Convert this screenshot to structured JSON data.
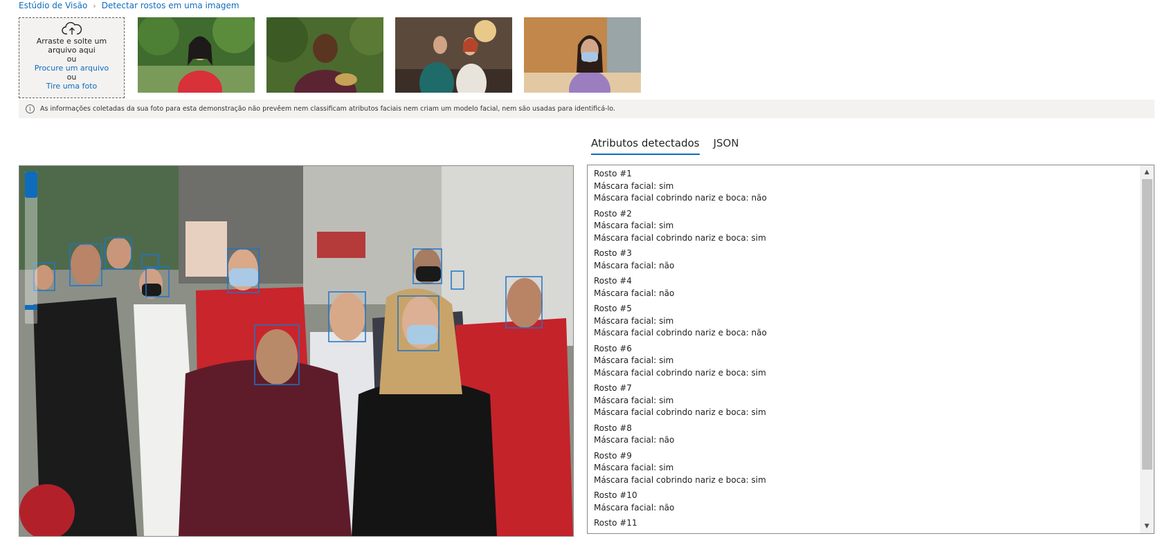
{
  "breadcrumb": {
    "root": "Estúdio de Visão",
    "current": "Detectar rostos em uma imagem"
  },
  "upload": {
    "drag_text": "Arraste e solte um arquivo aqui",
    "or1": "ou",
    "browse": "Procure um arquivo",
    "or2": "ou",
    "take_photo": "Tire uma foto"
  },
  "notice": "As informações coletadas da sua foto para esta demonstração não prevêem nem classificam atributos faciais nem criam um modelo facial, nem são usadas para identificá-lo.",
  "tabs": {
    "detected": "Atributos detectados",
    "json": "JSON"
  },
  "faces": [
    {
      "title": "Rosto #1",
      "mask": "Máscara facial: sim",
      "cover": "Máscara facial cobrindo nariz e boca: não"
    },
    {
      "title": "Rosto #2",
      "mask": "Máscara facial: sim",
      "cover": "Máscara facial cobrindo nariz e boca: sim"
    },
    {
      "title": "Rosto #3",
      "mask": "Máscara facial: não"
    },
    {
      "title": "Rosto #4",
      "mask": "Máscara facial: não"
    },
    {
      "title": "Rosto #5",
      "mask": "Máscara facial: sim",
      "cover": "Máscara facial cobrindo nariz e boca: não"
    },
    {
      "title": "Rosto #6",
      "mask": "Máscara facial: sim",
      "cover": "Máscara facial cobrindo nariz e boca: sim"
    },
    {
      "title": "Rosto #7",
      "mask": "Máscara facial: sim",
      "cover": "Máscara facial cobrindo nariz e boca: sim"
    },
    {
      "title": "Rosto #8",
      "mask": "Máscara facial: não"
    },
    {
      "title": "Rosto #9",
      "mask": "Máscara facial: sim",
      "cover": "Máscara facial cobrindo nariz e boca: sim"
    },
    {
      "title": "Rosto #10",
      "mask": "Máscara facial: não"
    },
    {
      "title": "Rosto #11"
    }
  ],
  "colors": {
    "accent": "#0f6cbd",
    "box": "#1e74c8"
  }
}
